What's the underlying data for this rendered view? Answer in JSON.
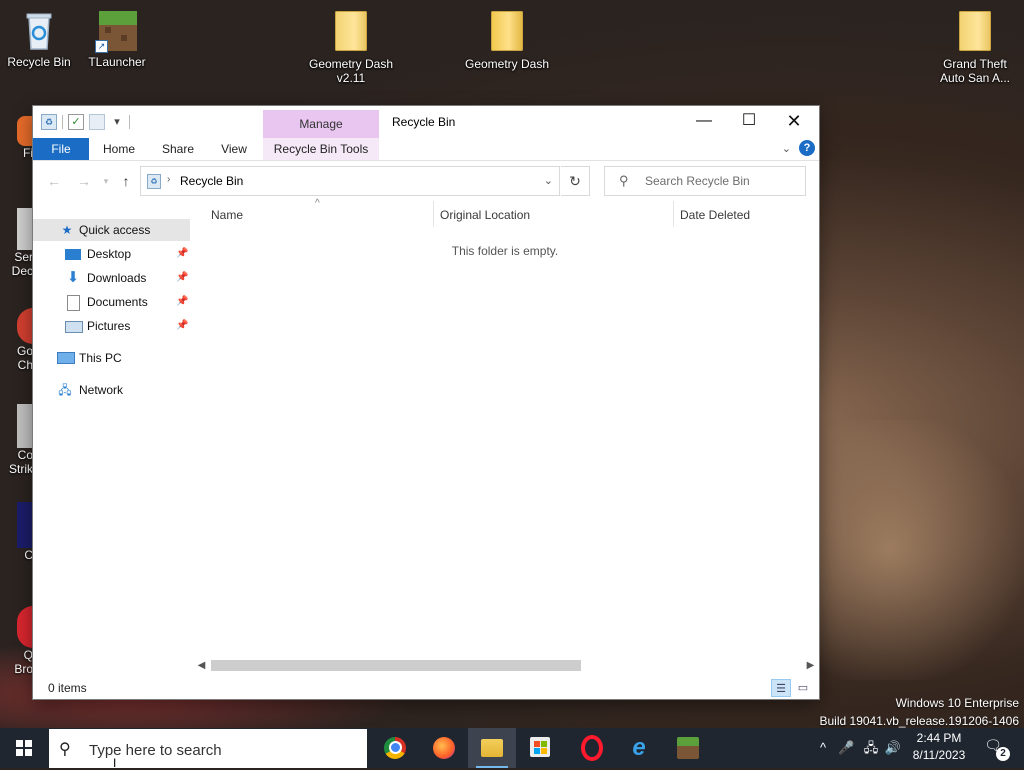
{
  "desktop": {
    "icons": [
      {
        "label": "Recycle Bin"
      },
      {
        "label": "TLauncher"
      },
      {
        "label": "Geometry Dash v2.11"
      },
      {
        "label": "Geometry Dash"
      },
      {
        "label": "Grand Theft Auto San A..."
      }
    ],
    "partial_labels": [
      "Fi",
      "Ser",
      "Dec",
      "Go",
      "Ch",
      "Co",
      "Strik",
      "C",
      "Q",
      "Bro"
    ]
  },
  "window": {
    "title": "Recycle Bin",
    "contextual_tab_group": "Manage",
    "ribbon_tabs": [
      "File",
      "Home",
      "Share",
      "View",
      "Recycle Bin Tools"
    ],
    "address_path": "Recycle Bin",
    "search_placeholder": "Search Recycle Bin",
    "navigation": {
      "quick_access": "Quick access",
      "pinned": [
        "Desktop",
        "Downloads",
        "Documents",
        "Pictures"
      ],
      "this_pc": "This PC",
      "network": "Network"
    },
    "columns": [
      "Name",
      "Original Location",
      "Date Deleted"
    ],
    "empty_message": "This folder is empty.",
    "status": "0 items"
  },
  "watermark": {
    "line1": "Windows 10 Enterprise",
    "line2": "Build 19041.vb_release.191206-1406"
  },
  "taskbar": {
    "search_placeholder": "Type here to search",
    "apps": [
      "chrome",
      "firefox",
      "file-explorer",
      "microsoft-store",
      "opera",
      "internet-explorer",
      "minecraft"
    ],
    "time": "2:44 PM",
    "date": "8/11/2023",
    "notification_count": "2"
  },
  "colors": {
    "accent": "#1a6cc4",
    "manage_tab": "#e9c6f0",
    "taskbar": "#1f2630",
    "selection": "#e5e5e5"
  }
}
